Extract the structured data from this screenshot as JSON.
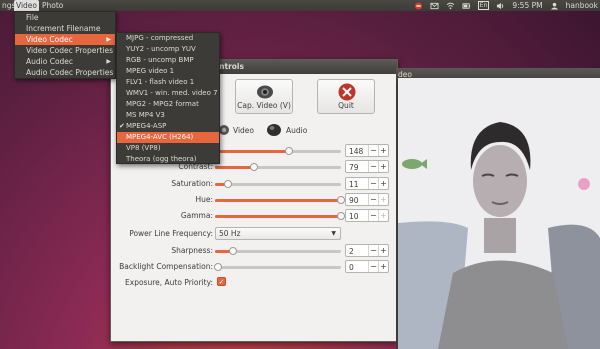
{
  "top_panel": {
    "left_fragment": "ngs",
    "menus": [
      "Video",
      "Photo"
    ],
    "tray": {
      "lang": "En",
      "time": "9:55 PM",
      "user": "hanbook"
    }
  },
  "video_menu": {
    "items": [
      "File",
      "Increment Filename",
      "Video Codec",
      "Video Codec Properties",
      "Audio Codec",
      "Audio Codec Properties"
    ],
    "highlighted_index": 2
  },
  "codec_submenu": {
    "items": [
      "MJPG - compressed",
      "YUY2 - uncomp YUV",
      "RGB - uncomp BMP",
      "MPEG video 1",
      "FLV1 - flash video 1",
      "WMV1 - win. med. video 7",
      "MPG2 - MPG2 format",
      "MS MP4 V3",
      "MPEG4-ASP",
      "MPEG4-AVC (H264)",
      "VP8 (VP8)",
      "Theora (ogg theora)"
    ],
    "checked_index": 8,
    "highlighted_index": 9
  },
  "controls_window": {
    "title": "ontrols",
    "buttons": {
      "cap_video": "Cap. Video (V)",
      "quit": "Quit"
    },
    "tabs": {
      "video": "Video",
      "audio": "Audio"
    },
    "controls": [
      {
        "label": "",
        "value": "148",
        "level": 0.59,
        "plus_enabled": true
      },
      {
        "label": "Contrast:",
        "value": "79",
        "level": 0.31,
        "plus_enabled": true
      },
      {
        "label": "Saturation:",
        "value": "11",
        "level": 0.1,
        "plus_enabled": true
      },
      {
        "label": "Hue:",
        "value": "90",
        "level": 1.0,
        "plus_enabled": false
      },
      {
        "label": "Gamma:",
        "value": "10",
        "level": 1.0,
        "plus_enabled": false
      },
      {
        "label": "Power Line Frequency:",
        "value": "50 Hz",
        "type": "combo"
      },
      {
        "label": "Sharpness:",
        "value": "2",
        "level": 0.14,
        "plus_enabled": true
      },
      {
        "label": "Backlight Compensation:",
        "value": "0",
        "level": 0.0,
        "plus_enabled": true
      },
      {
        "label": "Exposure, Auto Priority:",
        "checked": true,
        "type": "checkbox"
      }
    ]
  },
  "video_window": {
    "title": "deo"
  },
  "colors": {
    "accent": "#e8663d",
    "panel": "#3c3b37"
  }
}
